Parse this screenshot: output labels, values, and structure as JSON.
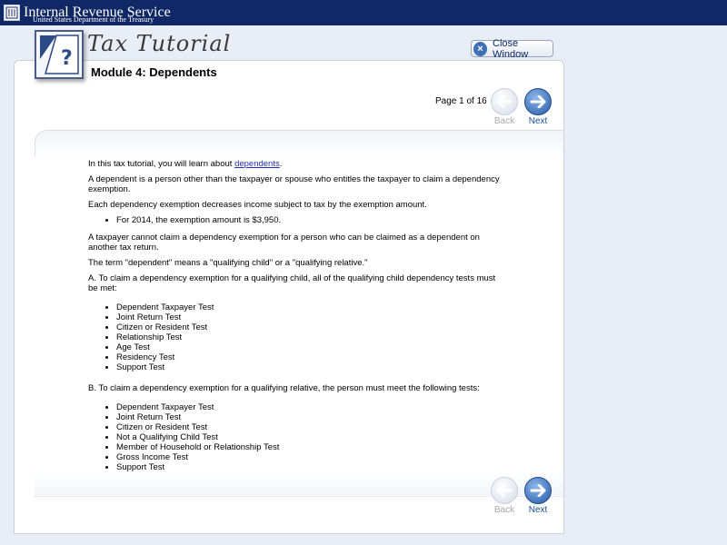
{
  "header": {
    "agency": "Internal Revenue Service",
    "department": "United States Department of the Treasury"
  },
  "app": {
    "title": "Tax Tutorial",
    "close_label": "Close Window"
  },
  "module": {
    "title": "Module 4: Dependents",
    "page_indicator": "Page 1 of 16"
  },
  "nav": {
    "back_label": "Back",
    "next_label": "Next"
  },
  "content": {
    "intro_prefix": "In this tax tutorial, you will learn about ",
    "intro_link": "dependents",
    "intro_suffix": ".",
    "p1": "A dependent is a person other than the taxpayer or spouse who entitles the taxpayer to claim a dependency exemption.",
    "p2": "Each dependency exemption decreases income subject to tax by the exemption amount.",
    "bullet_amount": "For 2014, the exemption amount is $3,950.",
    "p3": "A taxpayer cannot claim a dependency exemption for a person who can be claimed as a dependent on another tax return.",
    "p4": "The term \"dependent\" means a \"qualifying child\" or a \"qualifying relative.\"",
    "section_a": "A. To claim a dependency exemption for a qualifying child, all of the qualifying child dependency tests must be met:",
    "list_a": [
      "Dependent Taxpayer Test",
      "Joint Return Test",
      "Citizen or Resident Test",
      "Relationship Test",
      "Age Test",
      "Residency Test",
      "Support Test"
    ],
    "section_b": "B. To claim a dependency exemption for a qualifying relative, the person must meet the following tests:",
    "list_b": [
      "Dependent Taxpayer Test",
      "Joint Return Test",
      "Citizen or Resident Test",
      "Not a Qualifying Child Test",
      "Member of Household or Relationship Test",
      "Gross Income Test",
      "Support Test"
    ]
  },
  "colors": {
    "banner": "#112866",
    "link": "#1f2fbf",
    "next_button": "#245aa8"
  },
  "icons": {
    "seal": "irs-seal-icon",
    "logo": "question-book-icon",
    "close": "close-icon",
    "back": "back-arrow-icon",
    "next": "next-arrow-icon"
  }
}
